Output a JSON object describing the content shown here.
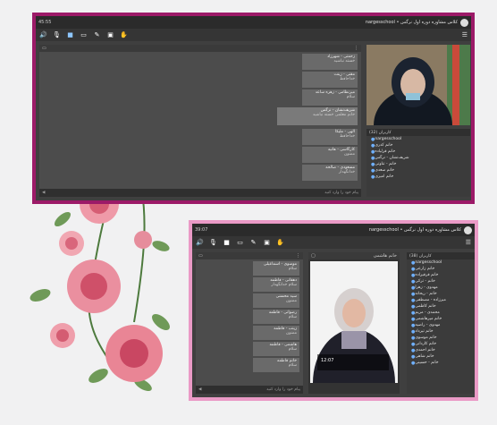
{
  "window1": {
    "title": "nargesschool • کلاس مشاوره دوره اول نرگس",
    "time": "45:55",
    "panel_dots": "⋮",
    "users_header": "کاربران (32)",
    "chat_placeholder": "پیام خود را وارد کنید",
    "messages": [
      {
        "name": "زحمتی - شهرزاد",
        "text": "خسته نباشید"
      },
      {
        "name": "مقتی - زینت",
        "text": "خداحافظ"
      },
      {
        "name": "میرنظامی - زهره ساعد",
        "text": "سلام"
      },
      {
        "name": "شریف‌نشان - نرگس",
        "text": "خانم معلمی خسته نباشید"
      },
      {
        "name": "الهی - ملیکا",
        "text": "خداحافظ"
      },
      {
        "name": "کارگاسی - هانیه",
        "text": "ممنون"
      },
      {
        "name": "مسعودی - صالحه",
        "text": "خدانگهدار"
      }
    ],
    "users": [
      "nargesschool",
      "خانم کدری",
      "خانم قزلیاده",
      "شریف‌نشان - نرگس",
      "خانم - تناوتی",
      "خانم سعدی",
      "خانم امیری"
    ]
  },
  "window2": {
    "title": "nargesschool • کلاس مشاوره دوره اول نرگس",
    "time": "39:07",
    "video_header": "خانم هاشمی",
    "users_header": "کاربران (38)",
    "chat_placeholder": "پیام خود را وارد کنید",
    "video_overlay_time": "12:07",
    "messages": [
      {
        "name": "موسوی - اسماعیلی",
        "text": "سلام"
      },
      {
        "name": "دهقانی - فاطمه",
        "text": "سلام خدانگهدار"
      },
      {
        "name": "سید محسنی",
        "text": "ممنون"
      },
      {
        "name": "رضوانی - فاطمه",
        "text": "سلام"
      },
      {
        "name": "زینب - فاطمه",
        "text": "ممنون"
      },
      {
        "name": "هاشمی - فاطمه",
        "text": "سلام"
      },
      {
        "name": "خانم فاطمه",
        "text": "سلام"
      }
    ],
    "users": [
      "nargesschool",
      "خانم زارعی",
      "خانم قرقیزاده",
      "خانم - ترکی",
      "مهدوی - زهرا",
      "خانم - ریحانه",
      "میرزاده - مصطفی",
      "خانم کاظمی",
      "محمدی - مریم",
      "خانم میرهاشمی",
      "مهدوی - راضیه",
      "خانم تیرداد",
      "خانم موسوی",
      "خانم کاردانی",
      "خانم احمدی",
      "خانم شاهی",
      "خانم - حسینی"
    ]
  },
  "colors": {
    "frame1": "#9c1a68",
    "frame2": "#ea9ac6",
    "accent": "#6fb0ff"
  }
}
